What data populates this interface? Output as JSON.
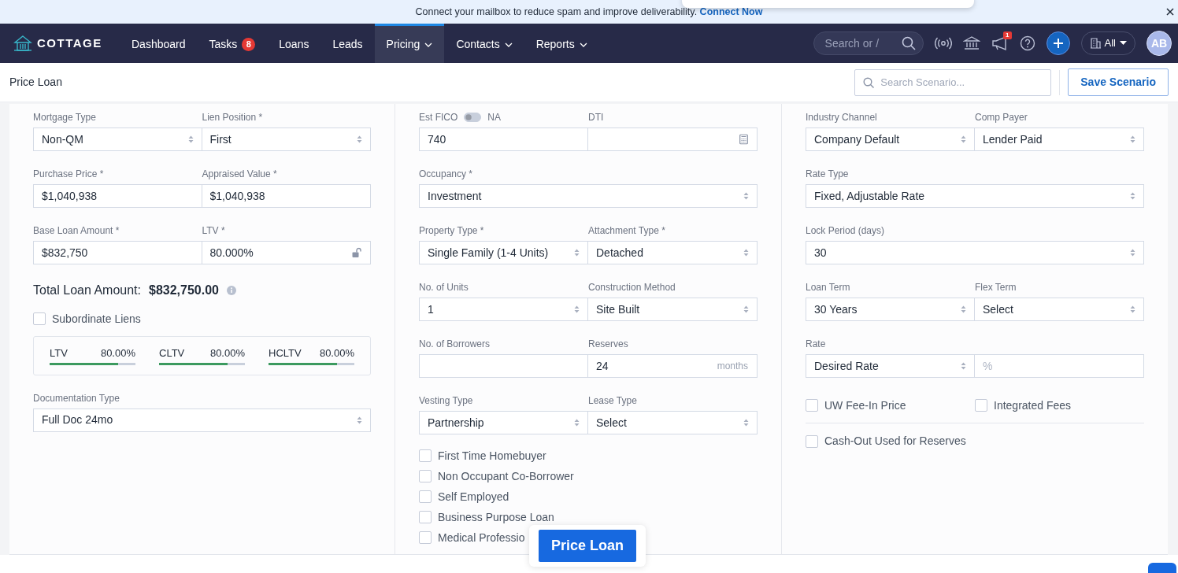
{
  "banner": {
    "text": "Connect your mailbox to reduce spam and improve deliverability.",
    "link": "Connect Now"
  },
  "navbar": {
    "logo": "COTTAGE",
    "items": [
      {
        "label": "Dashboard",
        "selected": false,
        "dropdown": false
      },
      {
        "label": "Tasks",
        "badge": "8",
        "selected": false,
        "dropdown": false
      },
      {
        "label": "Loans",
        "selected": false,
        "dropdown": false
      },
      {
        "label": "Leads",
        "selected": false,
        "dropdown": false
      },
      {
        "label": "Pricing",
        "selected": true,
        "dropdown": true
      },
      {
        "label": "Contacts",
        "selected": false,
        "dropdown": true
      },
      {
        "label": "Reports",
        "selected": false,
        "dropdown": true
      }
    ],
    "search": {
      "placeholder": "Search or /"
    },
    "notification_badge": "1",
    "org_filter": "All",
    "avatar": "AB"
  },
  "header": {
    "title": "Price Loan",
    "search": {
      "placeholder": "Search Scenario..."
    },
    "save_button": "Save Scenario"
  },
  "columns": [
    {
      "rows": [
        {
          "kind": "pair",
          "fields": [
            {
              "label": "Mortgage Type",
              "kind": "select",
              "value": "Non-QM"
            },
            {
              "label": "Lien Position *",
              "kind": "select",
              "value": "First"
            }
          ]
        },
        {
          "kind": "pair",
          "fields": [
            {
              "label": "Purchase Price *",
              "kind": "input",
              "value": "$1,040,938"
            },
            {
              "label": "Appraised Value *",
              "kind": "input",
              "value": "$1,040,938"
            }
          ]
        },
        {
          "kind": "pair",
          "fields": [
            {
              "label": "Base Loan Amount *",
              "kind": "input",
              "value": "$832,750"
            },
            {
              "label": "LTV *",
              "kind": "lock_input",
              "value": "80.000%"
            }
          ]
        },
        {
          "kind": "total",
          "label": "Total Loan Amount:",
          "value": "$832,750.00"
        },
        {
          "kind": "checklist",
          "items": [
            {
              "label": "Subordinate Liens",
              "checked": false
            }
          ]
        },
        {
          "kind": "meters",
          "items": [
            {
              "label": "LTV",
              "reading": "80.00%",
              "level": 0.8
            },
            {
              "label": "CLTV",
              "reading": "80.00%",
              "level": 0.8
            },
            {
              "label": "HCLTV",
              "reading": "80.00%",
              "level": 0.8
            }
          ]
        },
        {
          "kind": "single",
          "fields": [
            {
              "label": "Documentation Type",
              "kind": "select",
              "value": "Full Doc 24mo"
            }
          ]
        }
      ]
    },
    {
      "rows": [
        {
          "kind": "pair",
          "fields": [
            {
              "label": "Est FICO",
              "toggle": {
                "label": "NA",
                "on": false
              },
              "kind": "input",
              "value": "740"
            },
            {
              "label": "DTI",
              "kind": "calculator_input"
            }
          ]
        },
        {
          "kind": "single",
          "fields": [
            {
              "label": "Occupancy *",
              "kind": "select",
              "value": "Investment"
            }
          ]
        },
        {
          "kind": "pair",
          "fields": [
            {
              "label": "Property Type *",
              "kind": "select",
              "value": "Single Family (1-4 Units)"
            },
            {
              "label": "Attachment Type *",
              "kind": "select",
              "value": "Detached"
            }
          ]
        },
        {
          "kind": "pair",
          "fields": [
            {
              "label": "No. of Units",
              "kind": "select",
              "value": "1"
            },
            {
              "label": "Construction Method",
              "kind": "select",
              "value": "Site Built"
            }
          ]
        },
        {
          "kind": "pair",
          "fields": [
            {
              "label": "No. of Borrowers",
              "kind": "input"
            },
            {
              "label": "Reserves",
              "kind": "input",
              "value": "24",
              "suffix": "months"
            }
          ]
        },
        {
          "kind": "pair",
          "fields": [
            {
              "label": "Vesting Type",
              "kind": "select",
              "value": "Partnership"
            },
            {
              "label": "Lease Type",
              "kind": "select",
              "value": "Select"
            }
          ]
        },
        {
          "kind": "checklist",
          "items": [
            {
              "label": "First Time Homebuyer",
              "checked": false
            },
            {
              "label": "Non Occupant Co-Borrower",
              "checked": false
            },
            {
              "label": "Self Employed",
              "checked": false
            },
            {
              "label": "Business Purpose Loan",
              "checked": false
            },
            {
              "label": "Medical Professio",
              "checked": false
            }
          ]
        }
      ]
    },
    {
      "rows": [
        {
          "kind": "pair",
          "fields": [
            {
              "label": "Industry Channel",
              "kind": "select",
              "value": "Company Default"
            },
            {
              "label": "Comp Payer",
              "kind": "select",
              "value": "Lender Paid"
            }
          ]
        },
        {
          "kind": "single",
          "fields": [
            {
              "label": "Rate Type",
              "kind": "select",
              "value": "Fixed, Adjustable Rate"
            }
          ]
        },
        {
          "kind": "single",
          "fields": [
            {
              "label": "Lock Period (days)",
              "kind": "select",
              "value": "30"
            }
          ]
        },
        {
          "kind": "pair",
          "fields": [
            {
              "label": "Loan Term",
              "kind": "select",
              "value": "30 Years"
            },
            {
              "label": "Flex Term",
              "kind": "select",
              "value": "Select"
            }
          ]
        },
        {
          "kind": "pair",
          "fields": [
            {
              "label": "Rate",
              "kind": "select",
              "value": "Desired Rate"
            },
            {
              "kind": "input",
              "placeholder": "%"
            }
          ]
        },
        {
          "kind": "checkbox_pair",
          "items": [
            {
              "label": "UW Fee-In Price",
              "checked": false
            },
            {
              "label": "Integrated Fees",
              "checked": false
            }
          ]
        },
        {
          "kind": "divider"
        },
        {
          "kind": "checklist",
          "items": [
            {
              "label": "Cash-Out Used for Reserves",
              "checked": false
            }
          ]
        }
      ]
    }
  ],
  "price_button": "Price Loan"
}
